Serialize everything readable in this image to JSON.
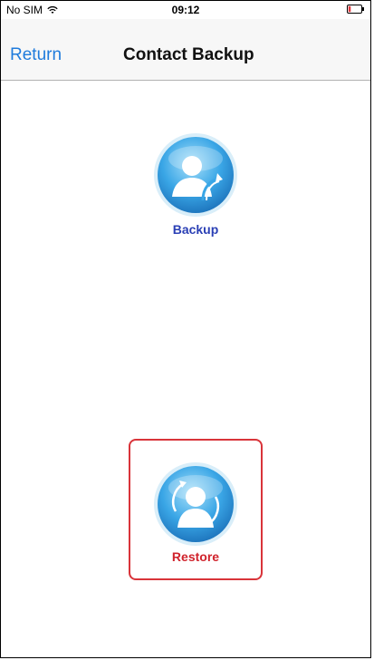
{
  "status_bar": {
    "carrier": "No SIM",
    "time": "09:12",
    "wifi_icon": "wifi-icon",
    "battery_icon": "battery-low-icon",
    "battery_color": "#e0383e"
  },
  "nav": {
    "back_label": "Return",
    "title": "Contact Backup",
    "back_color": "#1f7bdc"
  },
  "actions": {
    "backup": {
      "label": "Backup",
      "icon": "contact-backup-icon",
      "label_color": "#2a3fb5"
    },
    "restore": {
      "label": "Restore",
      "icon": "contact-restore-icon",
      "label_color": "#d0232c",
      "highlight_color": "#d9343a"
    }
  }
}
